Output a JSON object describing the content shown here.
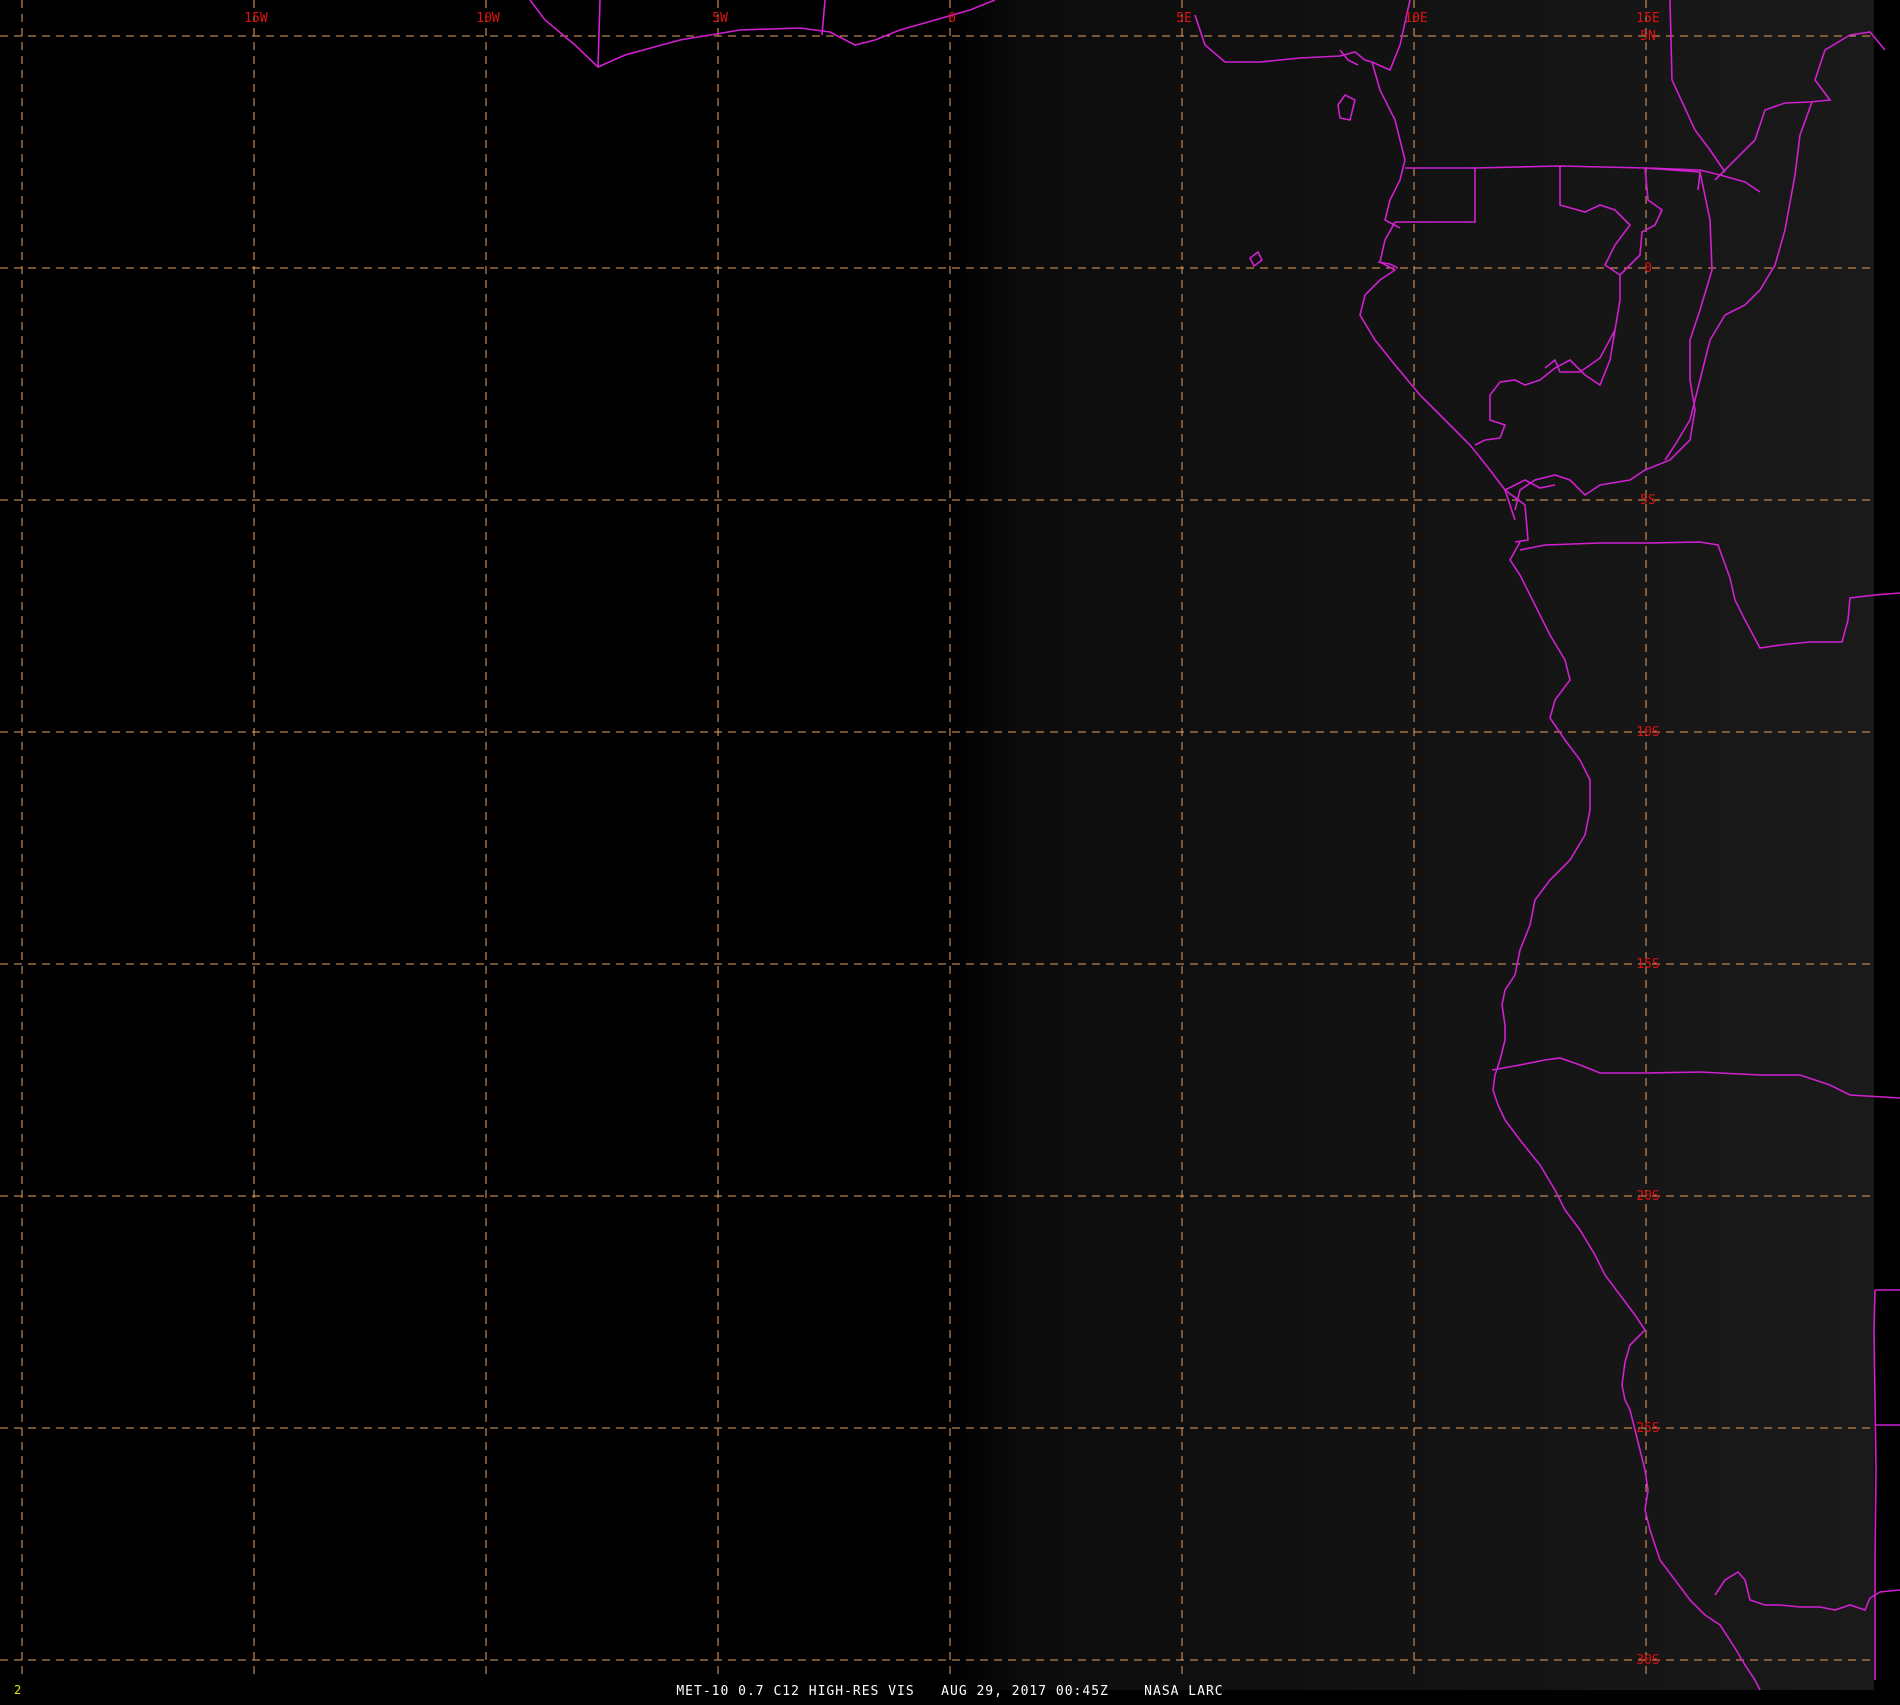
{
  "image": {
    "caption": "MET-10 0.7 C12 HIGH-RES VIS   AUG 29, 2017 00:45Z    NASA LARC",
    "frame_index": "2"
  },
  "grid": {
    "longitudes": [
      {
        "lon": -20,
        "label": ""
      },
      {
        "lon": -15,
        "label": "15W"
      },
      {
        "lon": -10,
        "label": "10W"
      },
      {
        "lon": -5,
        "label": "5W"
      },
      {
        "lon": 0,
        "label": "0"
      },
      {
        "lon": 5,
        "label": "5E"
      },
      {
        "lon": 10,
        "label": "10E"
      },
      {
        "lon": 15,
        "label": "15E"
      }
    ],
    "latitudes": [
      {
        "lat": 5,
        "label": "5N"
      },
      {
        "lat": 0,
        "label": "0"
      },
      {
        "lat": -5,
        "label": "5S"
      },
      {
        "lat": -10,
        "label": "10S"
      },
      {
        "lat": -15,
        "label": "15S"
      },
      {
        "lat": -20,
        "label": "20S"
      },
      {
        "lat": -25,
        "label": "25S"
      },
      {
        "lat": -30,
        "label": "30S"
      }
    ],
    "line_color": "#e8a060",
    "label_color": "#e01010"
  },
  "colors": {
    "background": "#000000",
    "land_tint": "#161616",
    "boundary": "#d020d0"
  }
}
